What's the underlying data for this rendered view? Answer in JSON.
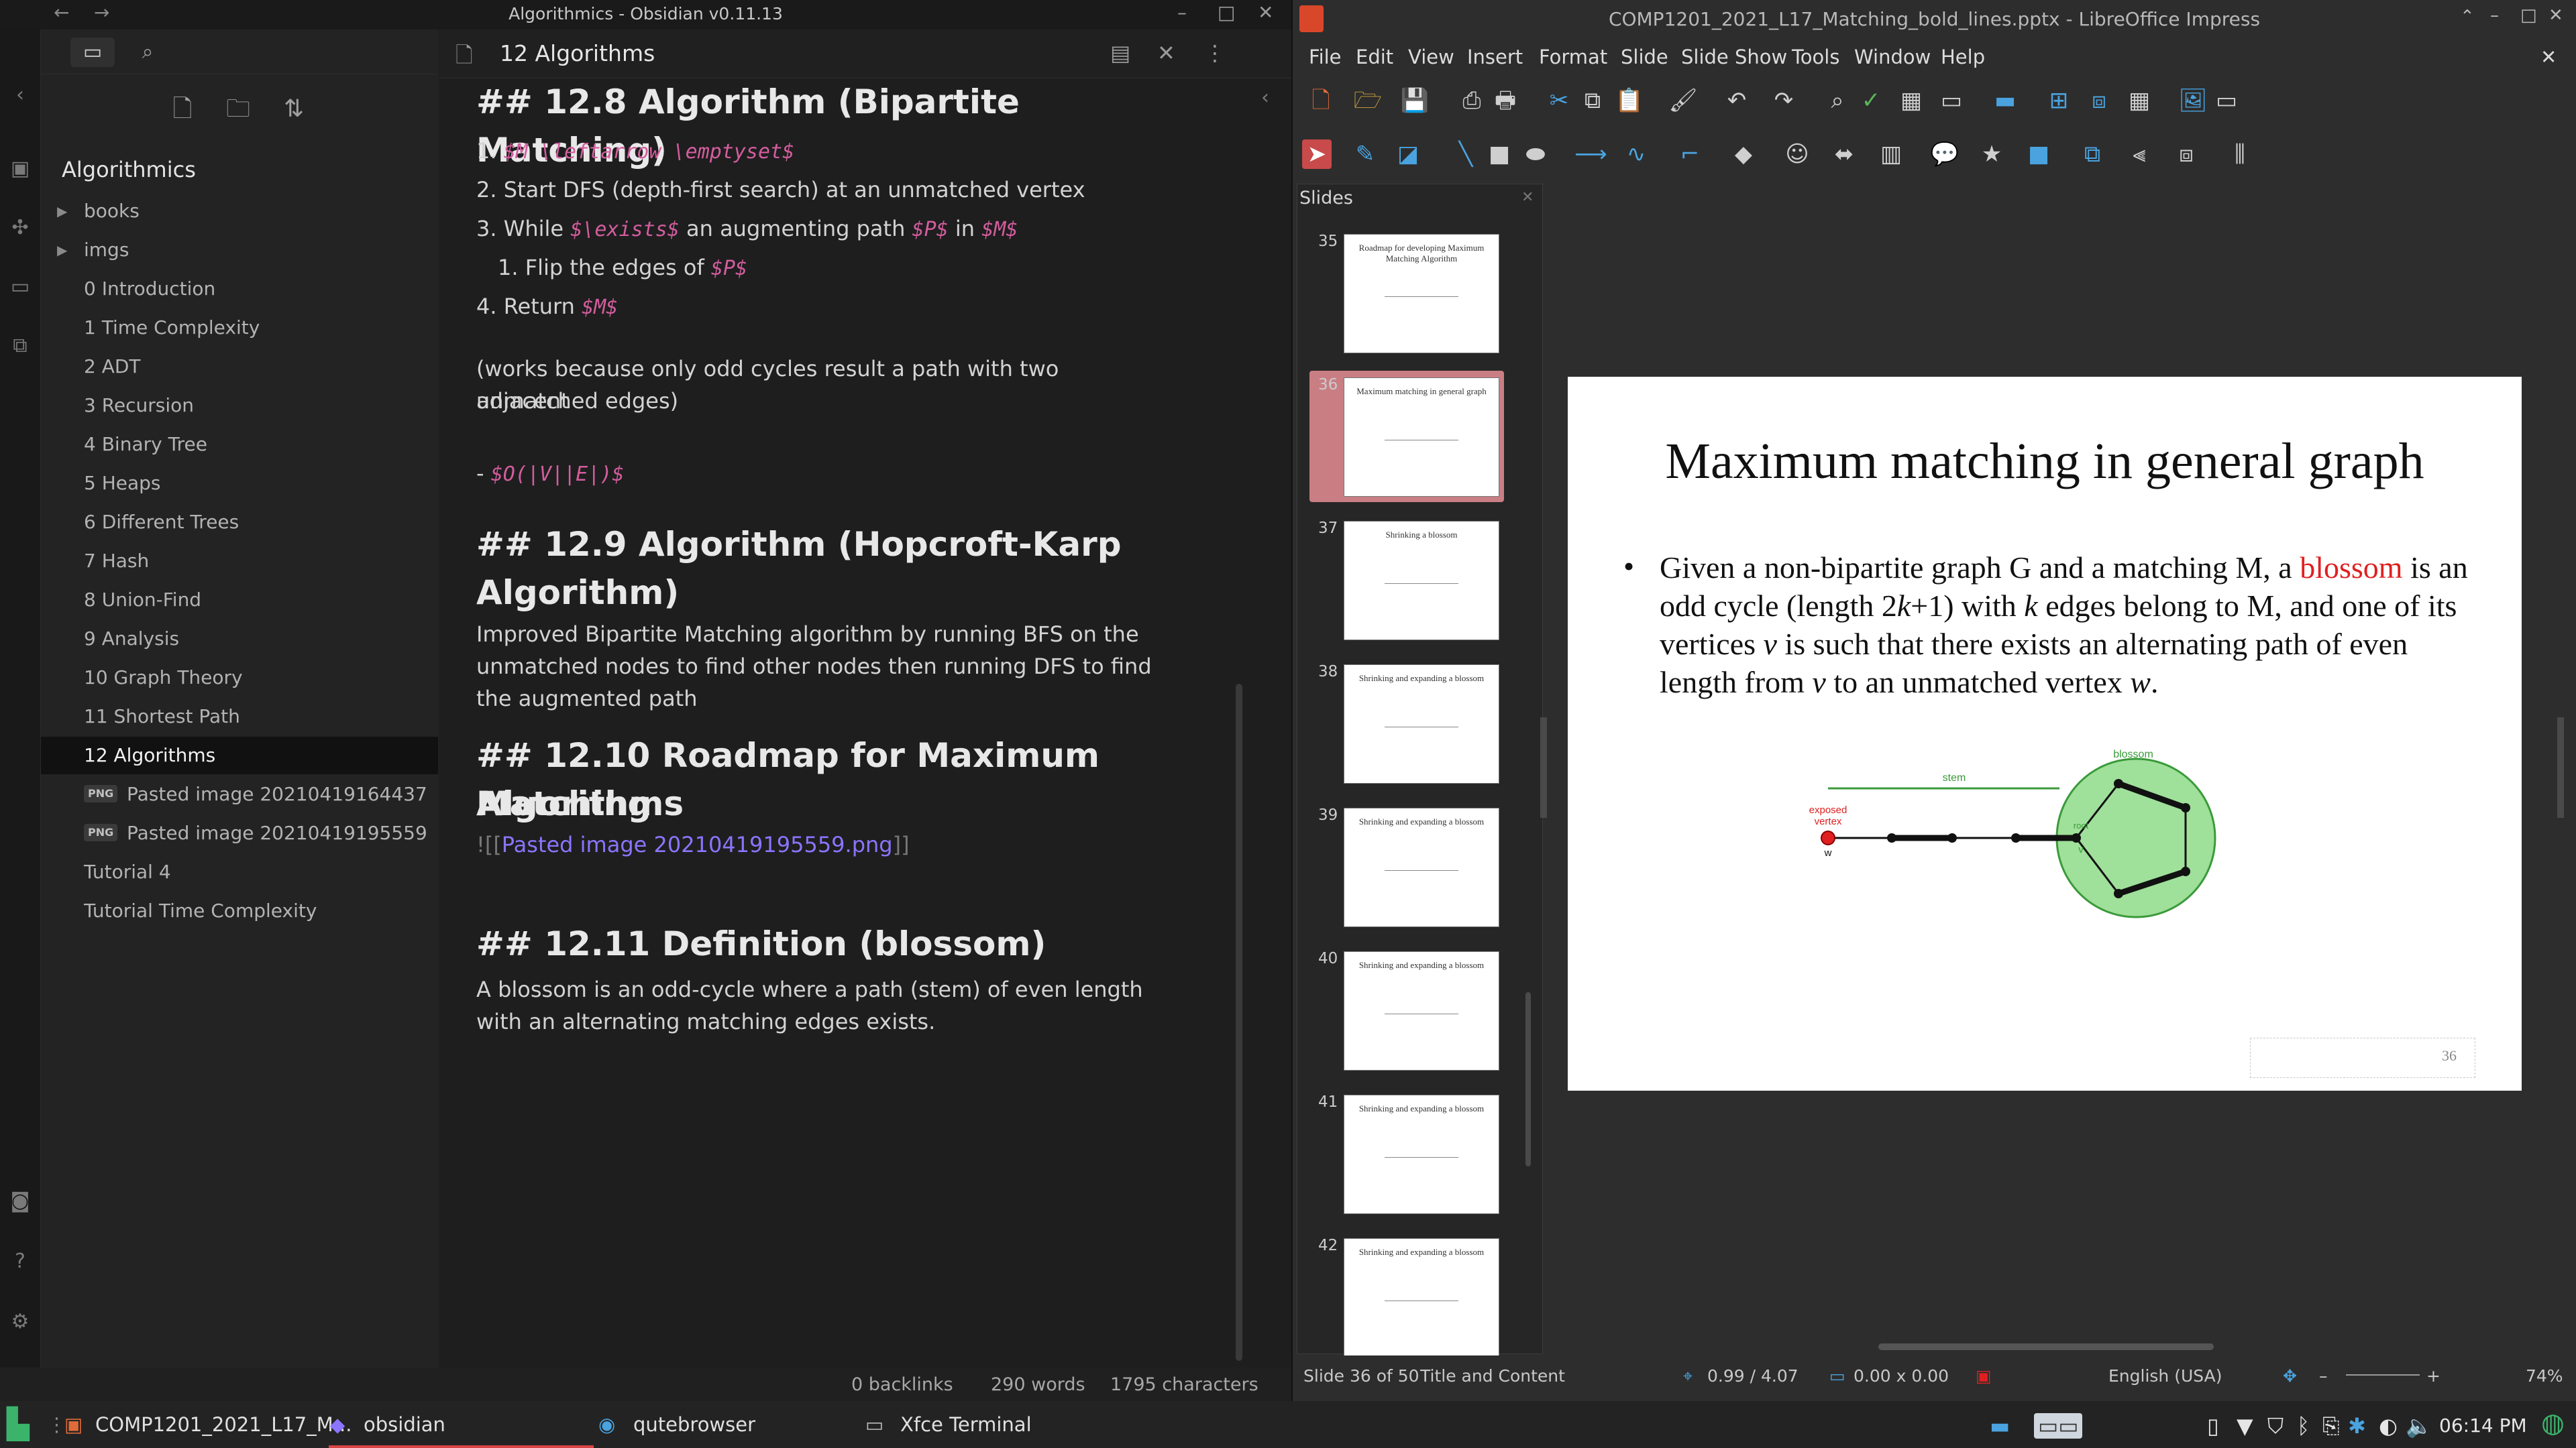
{
  "obsidian": {
    "window_title": "Algorithmics - Obsidian v0.11.13",
    "vault_name": "Algorithmics",
    "tree": [
      {
        "label": "books",
        "kind": "folder"
      },
      {
        "label": "imgs",
        "kind": "folder"
      },
      {
        "label": "0 Introduction",
        "kind": "file"
      },
      {
        "label": "1 Time Complexity",
        "kind": "file"
      },
      {
        "label": "2 ADT",
        "kind": "file"
      },
      {
        "label": "3 Recursion",
        "kind": "file"
      },
      {
        "label": "4 Binary Tree",
        "kind": "file"
      },
      {
        "label": "5 Heaps",
        "kind": "file"
      },
      {
        "label": "6 Different Trees",
        "kind": "file"
      },
      {
        "label": "7 Hash",
        "kind": "file"
      },
      {
        "label": "8 Union-Find",
        "kind": "file"
      },
      {
        "label": "9 Analysis",
        "kind": "file"
      },
      {
        "label": "10 Graph Theory",
        "kind": "file"
      },
      {
        "label": "11 Shortest Path",
        "kind": "file"
      },
      {
        "label": "12 Algorithms",
        "kind": "file",
        "selected": true
      },
      {
        "label": "Pasted image 20210419164437",
        "kind": "png",
        "badge": "PNG"
      },
      {
        "label": "Pasted image 20210419195559",
        "kind": "png",
        "badge": "PNG"
      },
      {
        "label": "Tutorial 4",
        "kind": "file"
      },
      {
        "label": "Tutorial Time Complexity",
        "kind": "file"
      }
    ],
    "editor": {
      "tab_title": "12 Algorithms",
      "h_12_8": "## 12.8 Algorithm (Bipartite Matching)",
      "step1_num": "1.",
      "step1_math": "$M \\leftarrow \\emptyset$",
      "step2_num": "2.",
      "step2_text": "Start DFS (depth-first search) at an unmatched vertex",
      "step3_num": "3.",
      "step3_a": "While ",
      "step3_m1": "$\\exists$",
      "step3_b": " an augmenting path ",
      "step3_m2": "$P$",
      "step3_c": " in ",
      "step3_m3": "$M$",
      "sub1_num": "1.",
      "sub1_text": "Flip the edges of ",
      "sub1_math": "$P$",
      "step4_num": "4.",
      "step4_text": "Return ",
      "step4_math": "$M$",
      "note_line1": "(works because only odd cycles result a path with two adjacent",
      "note_line2": "unmatched edges)",
      "complexity_dash": "- ",
      "complexity_math": "$O(|V||E|)$",
      "h_12_9_line1": "## 12.9 Algorithm (Hopcroft-Karp",
      "h_12_9_line2": "Algorithm)",
      "hk_line1": "Improved Bipartite Matching algorithm by running BFS on the",
      "hk_line2": "unmatched nodes to find other nodes then running DFS to find",
      "hk_line3": "the augmented path",
      "h_12_10_line1": "##  12.10 Roadmap for Maximum Matching",
      "h_12_10_line2": "Algorithms",
      "embed_prefix": "![[",
      "embed_link": "Pasted image 20210419195559.png",
      "embed_suffix": "]]",
      "h_12_11": "## 12.11 Definition (blossom)",
      "blossom_line1": "A blossom is an odd-cycle where a path (stem) of even length",
      "blossom_line2": "with an alternating matching edges exists."
    },
    "status": {
      "backlinks": "0 backlinks",
      "words": "290 words",
      "characters": "1795 characters"
    }
  },
  "impress": {
    "window_title": "COMP1201_2021_L17_Matching_bold_lines.pptx - LibreOffice Impress",
    "menu": [
      "File",
      "Edit",
      "View",
      "Insert",
      "Format",
      "Slide",
      "Slide Show",
      "Tools",
      "Window",
      "Help"
    ],
    "slides_panel_title": "Slides",
    "thumbnails": [
      {
        "num": "35",
        "title": "Roadmap for developing Maximum Matching Algorithm"
      },
      {
        "num": "36",
        "title": "Maximum matching in general graph",
        "selected": true
      },
      {
        "num": "37",
        "title": "Shrinking a blossom"
      },
      {
        "num": "38",
        "title": "Shrinking and expanding a blossom"
      },
      {
        "num": "39",
        "title": "Shrinking and expanding a blossom"
      },
      {
        "num": "40",
        "title": "Shrinking and expanding a blossom"
      },
      {
        "num": "41",
        "title": "Shrinking and expanding a blossom"
      },
      {
        "num": "42",
        "title": "Shrinking and expanding a blossom"
      }
    ],
    "slide": {
      "title": "Maximum matching in general graph",
      "bullet": "•",
      "t1": "Given a non-bipartite graph G and a matching M, a ",
      "t_red": "blossom",
      "t2": " is an odd cycle (length 2",
      "t_k1": "k",
      "t3": "+1) with ",
      "t_k2": "k",
      "t4": " edges belong to M, and one of its vertices ",
      "t_v1": "v",
      "t5": " is such that there exists an alternating path of even length from ",
      "t_v2": "v",
      "t6": " to an unmatched vertex ",
      "t_w": "w",
      "t7": ".",
      "diagram": {
        "stem": "stem",
        "blossom": "blossom",
        "exposed_line1": "exposed",
        "exposed_line2": "vertex",
        "w": "w",
        "root": "root",
        "v": "v"
      },
      "number": "36"
    },
    "status": {
      "slide_of": "Slide 36 of 50",
      "layout": "Title and Content",
      "position": "0.99 / 4.07",
      "size": "0.00 x 0.00",
      "language": "English (USA)",
      "zoom": "74%"
    }
  },
  "taskbar": {
    "apps": [
      {
        "label": "COMP1201_2021_L17_M...",
        "badge": ""
      },
      {
        "label": "obsidian",
        "badge": "3"
      },
      {
        "label": "qutebrowser",
        "badge": "2"
      },
      {
        "label": "Xfce Terminal",
        "badge": "4"
      }
    ],
    "clock": "06:14 PM"
  },
  "colors": {
    "obsidian_accent": "#8a75ff",
    "math": "#d35d9e",
    "blossom_fill": "#9fe09a",
    "red": "#e02020",
    "slide_thumb_selected": "#c97e84"
  }
}
